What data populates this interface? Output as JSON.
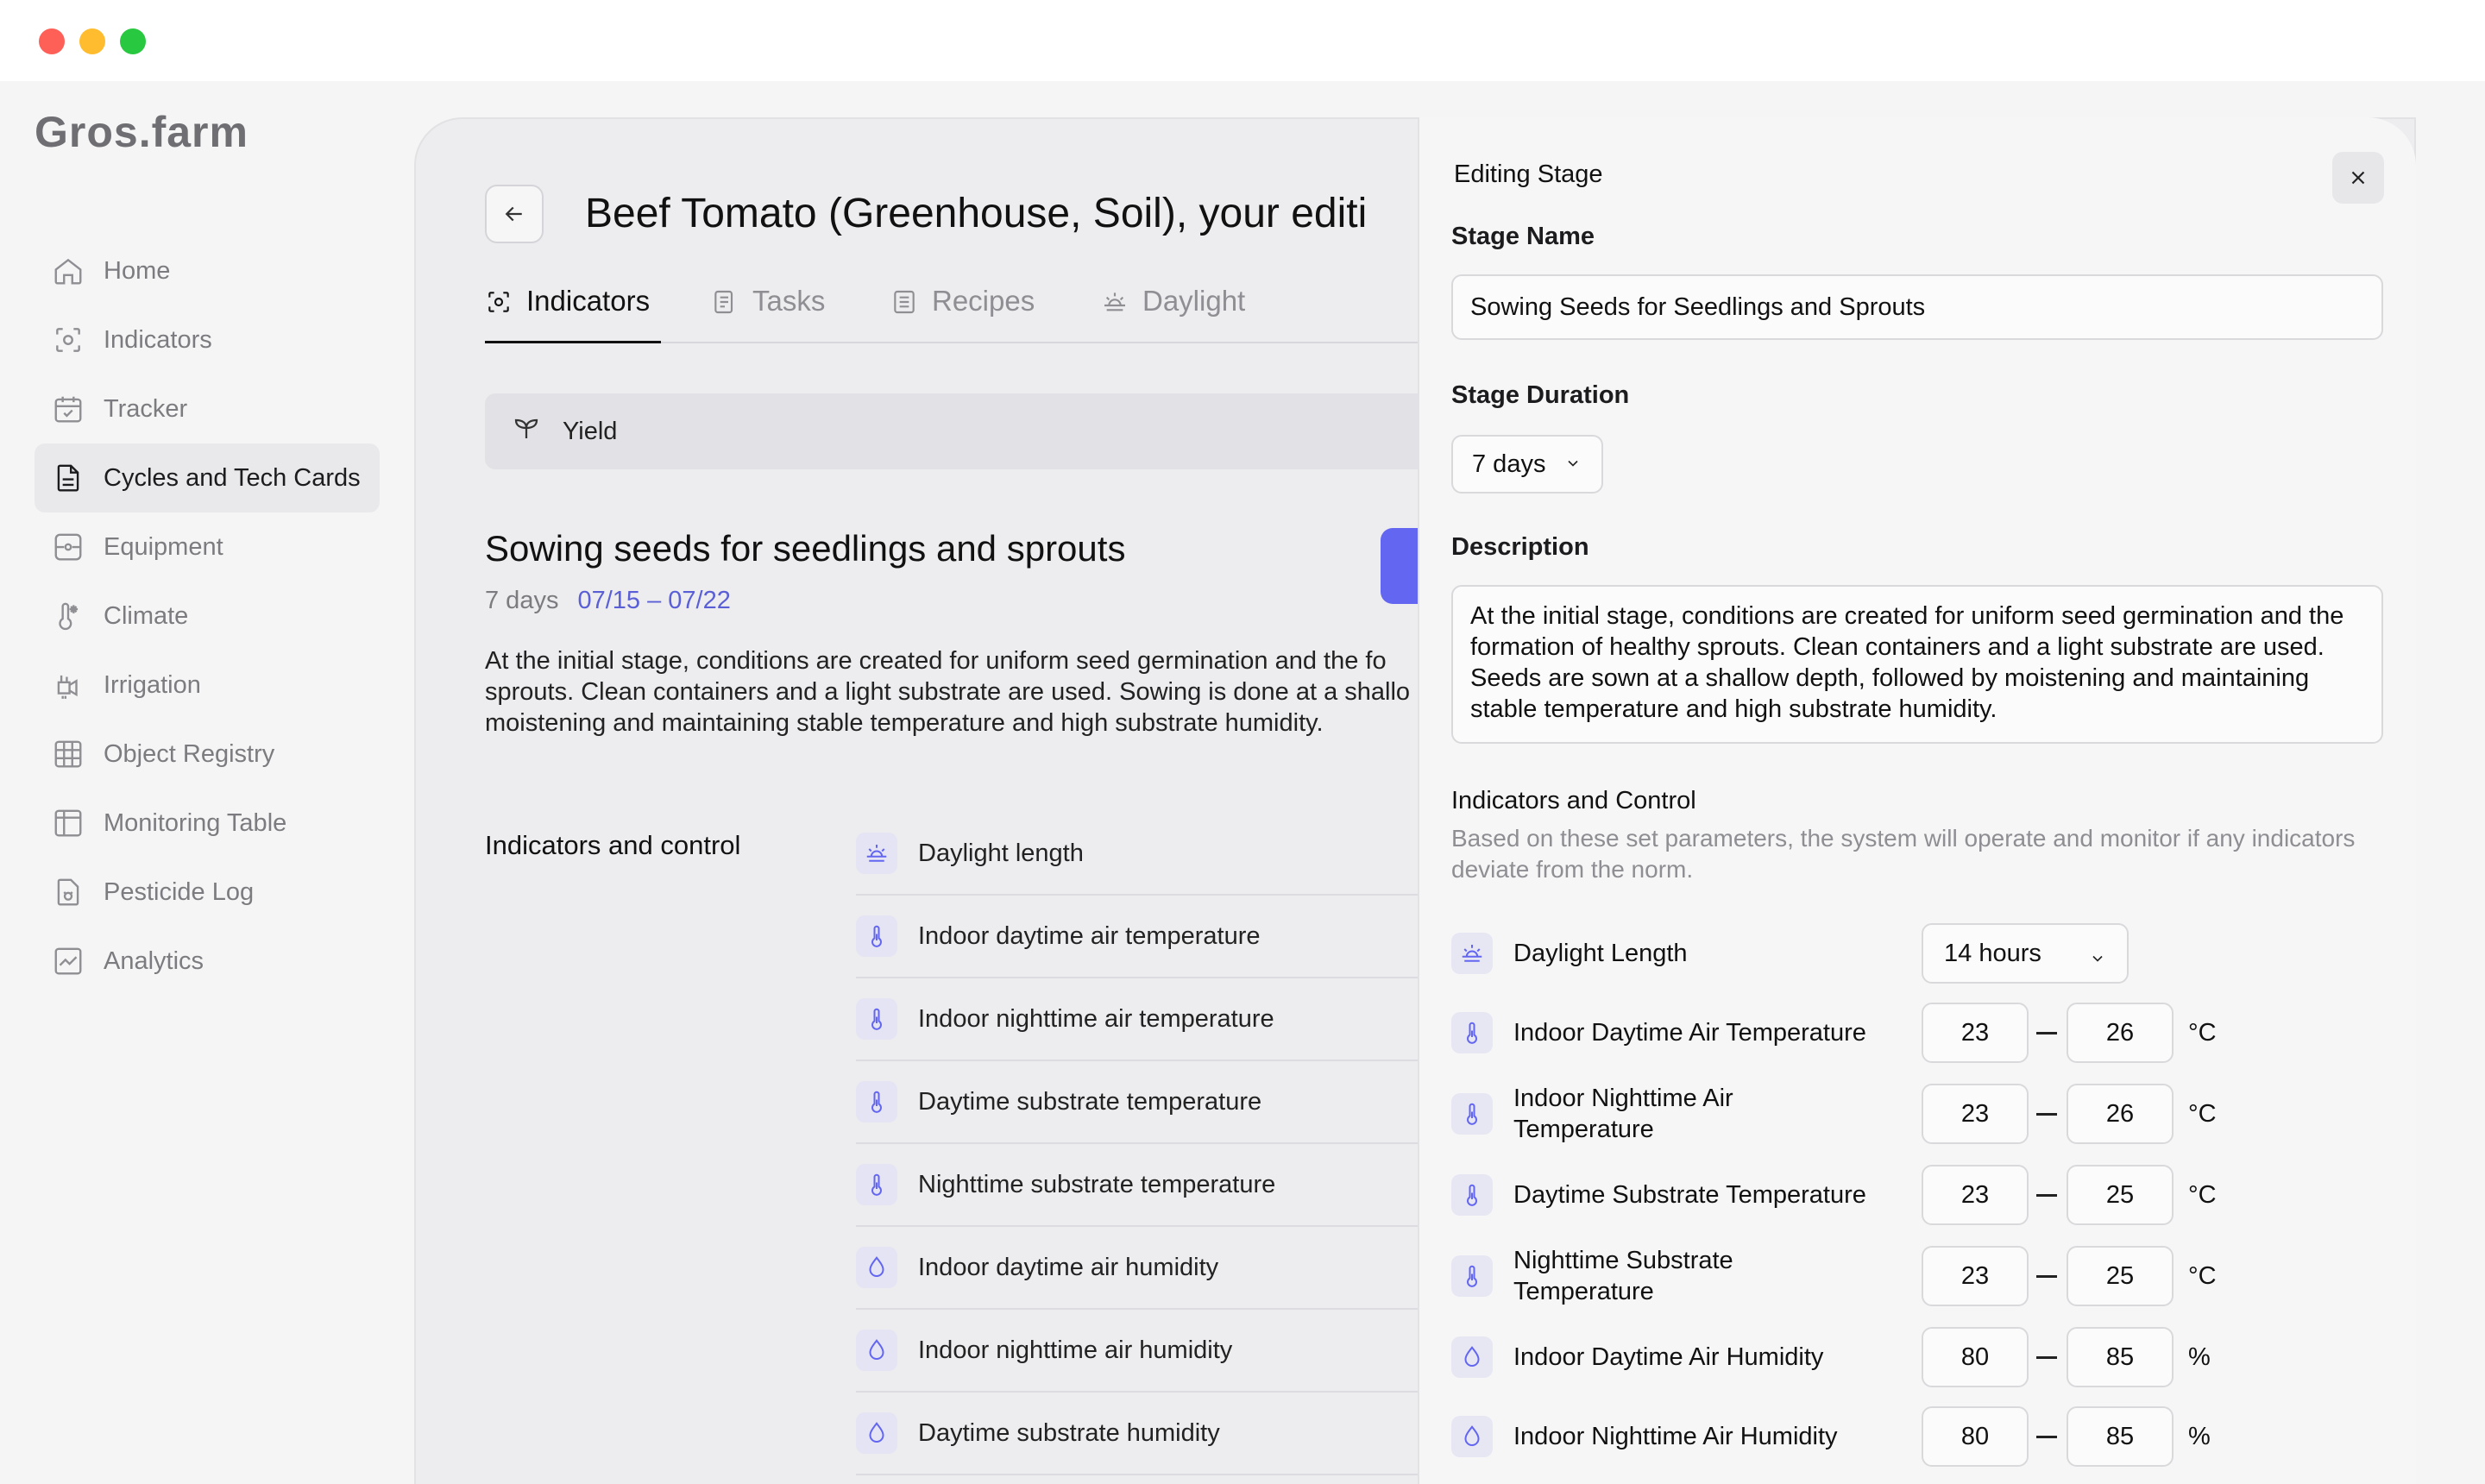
{
  "brand": {
    "logo": "Gros.farm"
  },
  "sidebar": {
    "items": [
      {
        "label": "Home",
        "icon": "home-icon"
      },
      {
        "label": "Indicators",
        "icon": "indicators-icon"
      },
      {
        "label": "Tracker",
        "icon": "tracker-icon"
      },
      {
        "label": "Cycles and Tech Cards",
        "icon": "document-icon",
        "active": true
      },
      {
        "label": "Equipment",
        "icon": "equipment-icon"
      },
      {
        "label": "Climate",
        "icon": "climate-icon"
      },
      {
        "label": "Irrigation",
        "icon": "irrigation-icon"
      },
      {
        "label": "Object Registry",
        "icon": "grid-icon"
      },
      {
        "label": "Monitoring Table",
        "icon": "table-icon"
      },
      {
        "label": "Pesticide Log",
        "icon": "pesticide-icon"
      },
      {
        "label": "Analytics",
        "icon": "analytics-icon"
      }
    ]
  },
  "main": {
    "title": "Beef Tomato (Greenhouse, Soil), your editi",
    "tabs": [
      {
        "label": "Indicators",
        "active": true
      },
      {
        "label": "Tasks"
      },
      {
        "label": "Recipes"
      },
      {
        "label": "Daylight"
      }
    ],
    "yield_label": "Yield",
    "stage": {
      "title": "Sowing seeds for seedlings and sprouts",
      "duration": "7 days",
      "dates": "07/15 – 07/22",
      "description_lines": [
        "At the initial stage, conditions are created for uniform seed germination and the fo",
        "sprouts. Clean containers and a light substrate are used. Sowing is done at a shallo",
        "moistening and maintaining stable temperature and high substrate humidity."
      ]
    },
    "indicators_heading": "Indicators and control",
    "indicators": [
      {
        "label": "Daylight length",
        "icon": "sun-icon"
      },
      {
        "label": "Indoor daytime air temperature",
        "icon": "thermometer-icon"
      },
      {
        "label": "Indoor nighttime air temperature",
        "icon": "thermometer-icon"
      },
      {
        "label": "Daytime substrate temperature",
        "icon": "thermometer-icon"
      },
      {
        "label": "Nighttime substrate temperature",
        "icon": "thermometer-icon"
      },
      {
        "label": "Indoor daytime air humidity",
        "icon": "droplet-icon"
      },
      {
        "label": "Indoor nighttime air humidity",
        "icon": "droplet-icon"
      },
      {
        "label": "Daytime substrate humidity",
        "icon": "droplet-icon"
      }
    ]
  },
  "panel": {
    "title": "Editing Stage",
    "stage_name_label": "Stage Name",
    "stage_name_value": "Sowing Seeds for Seedlings and Sprouts",
    "duration_label": "Stage Duration",
    "duration_value": "7 days",
    "description_label": "Description",
    "description_value": "At the initial stage, conditions are created for uniform seed germination and the formation of healthy sprouts. Clean containers and a light substrate are used. Seeds are sown at a shallow depth, followed by moistening and maintaining stable temperature and high substrate humidity.",
    "ic_title": "Indicators and Control",
    "ic_help": "Based on these set parameters, the system will operate and monitor if any indicators deviate from the norm.",
    "daylight": {
      "label": "Daylight Length",
      "value": "14 hours"
    },
    "params": [
      {
        "label": "Indoor Daytime Air Temperature",
        "min": "23",
        "max": "26",
        "unit": "°C",
        "icon": "thermometer-icon"
      },
      {
        "label": "Indoor Nighttime Air Temperature",
        "min": "23",
        "max": "26",
        "unit": "°C",
        "icon": "thermometer-icon"
      },
      {
        "label": "Daytime Substrate Temperature",
        "min": "23",
        "max": "25",
        "unit": "°C",
        "icon": "thermometer-icon"
      },
      {
        "label": "Nighttime Substrate Temperature",
        "min": "23",
        "max": "25",
        "unit": "°C",
        "icon": "thermometer-icon"
      },
      {
        "label": "Indoor Daytime Air Humidity",
        "min": "80",
        "max": "85",
        "unit": "%",
        "icon": "droplet-icon"
      },
      {
        "label": "Indoor Nighttime Air Humidity",
        "min": "80",
        "max": "85",
        "unit": "%",
        "icon": "droplet-icon"
      }
    ]
  },
  "colors": {
    "accent": "#6366f1",
    "dates": "#5a5fd6",
    "icon_bg": "#e4e4f4"
  }
}
